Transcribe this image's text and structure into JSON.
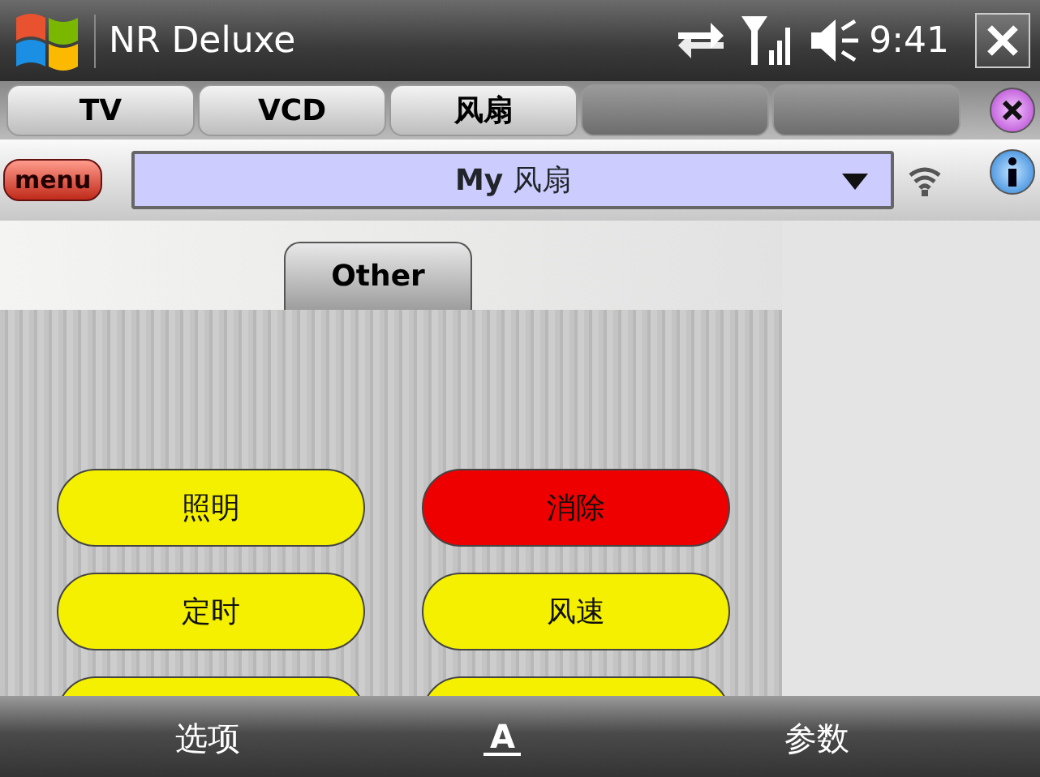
{
  "title_bar": {
    "title": "NR Deluxe",
    "time": "9:41"
  },
  "device_tabs": [
    {
      "kind": "labeled",
      "label": "TV"
    },
    {
      "kind": "labeled",
      "label": "VCD"
    },
    {
      "kind": "labeled",
      "label": "风扇"
    },
    {
      "kind": "blank"
    },
    {
      "kind": "blank"
    }
  ],
  "menu_button": "menu",
  "device_select": {
    "value_bold": "My",
    "value": "风扇"
  },
  "page_tab": "Other",
  "buttons": [
    {
      "label": "照明",
      "color": "#f5f000"
    },
    {
      "label": "消除",
      "color": "#ee0000"
    },
    {
      "label": "定时",
      "color": "#f5f000"
    },
    {
      "label": "风速",
      "color": "#f5f000"
    },
    {
      "color": "#f5f000"
    },
    {
      "color": "#f5f000"
    }
  ],
  "bottom_bar": {
    "left": "选项",
    "input_key": "A",
    "right": "参数"
  }
}
